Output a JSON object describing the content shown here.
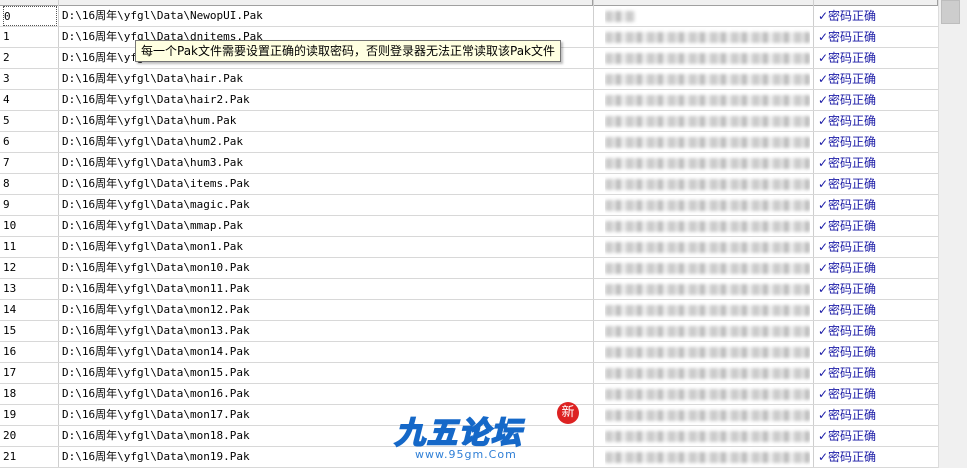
{
  "tooltip": "每一个Pak文件需要设置正确的读取密码，否则登录器无法正常读取该Pak文件",
  "rows": [
    {
      "index": "0",
      "path": "D:\\16周年\\yfgl\\Data\\NewopUI.Pak",
      "status": "✓密码正确"
    },
    {
      "index": "1",
      "path": "D:\\16周年\\yfgl\\Data\\dnitems.Pak",
      "status": "✓密码正确"
    },
    {
      "index": "2",
      "path": "D:\\16周年\\yfgl\\Data\\effect.Pak",
      "status": "✓密码正确"
    },
    {
      "index": "3",
      "path": "D:\\16周年\\yfgl\\Data\\hair.Pak",
      "status": "✓密码正确"
    },
    {
      "index": "4",
      "path": "D:\\16周年\\yfgl\\Data\\hair2.Pak",
      "status": "✓密码正确"
    },
    {
      "index": "5",
      "path": "D:\\16周年\\yfgl\\Data\\hum.Pak",
      "status": "✓密码正确"
    },
    {
      "index": "6",
      "path": "D:\\16周年\\yfgl\\Data\\hum2.Pak",
      "status": "✓密码正确"
    },
    {
      "index": "7",
      "path": "D:\\16周年\\yfgl\\Data\\hum3.Pak",
      "status": "✓密码正确"
    },
    {
      "index": "8",
      "path": "D:\\16周年\\yfgl\\Data\\items.Pak",
      "status": "✓密码正确"
    },
    {
      "index": "9",
      "path": "D:\\16周年\\yfgl\\Data\\magic.Pak",
      "status": "✓密码正确"
    },
    {
      "index": "10",
      "path": "D:\\16周年\\yfgl\\Data\\mmap.Pak",
      "status": "✓密码正确"
    },
    {
      "index": "11",
      "path": "D:\\16周年\\yfgl\\Data\\mon1.Pak",
      "status": "✓密码正确"
    },
    {
      "index": "12",
      "path": "D:\\16周年\\yfgl\\Data\\mon10.Pak",
      "status": "✓密码正确"
    },
    {
      "index": "13",
      "path": "D:\\16周年\\yfgl\\Data\\mon11.Pak",
      "status": "✓密码正确"
    },
    {
      "index": "14",
      "path": "D:\\16周年\\yfgl\\Data\\mon12.Pak",
      "status": "✓密码正确"
    },
    {
      "index": "15",
      "path": "D:\\16周年\\yfgl\\Data\\mon13.Pak",
      "status": "✓密码正确"
    },
    {
      "index": "16",
      "path": "D:\\16周年\\yfgl\\Data\\mon14.Pak",
      "status": "✓密码正确"
    },
    {
      "index": "17",
      "path": "D:\\16周年\\yfgl\\Data\\mon15.Pak",
      "status": "✓密码正确"
    },
    {
      "index": "18",
      "path": "D:\\16周年\\yfgl\\Data\\mon16.Pak",
      "status": "✓密码正确"
    },
    {
      "index": "19",
      "path": "D:\\16周年\\yfgl\\Data\\mon17.Pak",
      "status": "✓密码正确"
    },
    {
      "index": "20",
      "path": "D:\\16周年\\yfgl\\Data\\mon18.Pak",
      "status": "✓密码正确"
    },
    {
      "index": "21",
      "path": "D:\\16周年\\yfgl\\Data\\mon19.Pak",
      "status": "✓密码正确"
    }
  ],
  "watermark": {
    "title": "九五论坛",
    "url": "www.95gm.Com",
    "badge": "新"
  },
  "colors": {
    "status_text": "#1a1aa6",
    "tooltip_bg": "#ffffe1",
    "watermark_blue": "#1568c8"
  }
}
